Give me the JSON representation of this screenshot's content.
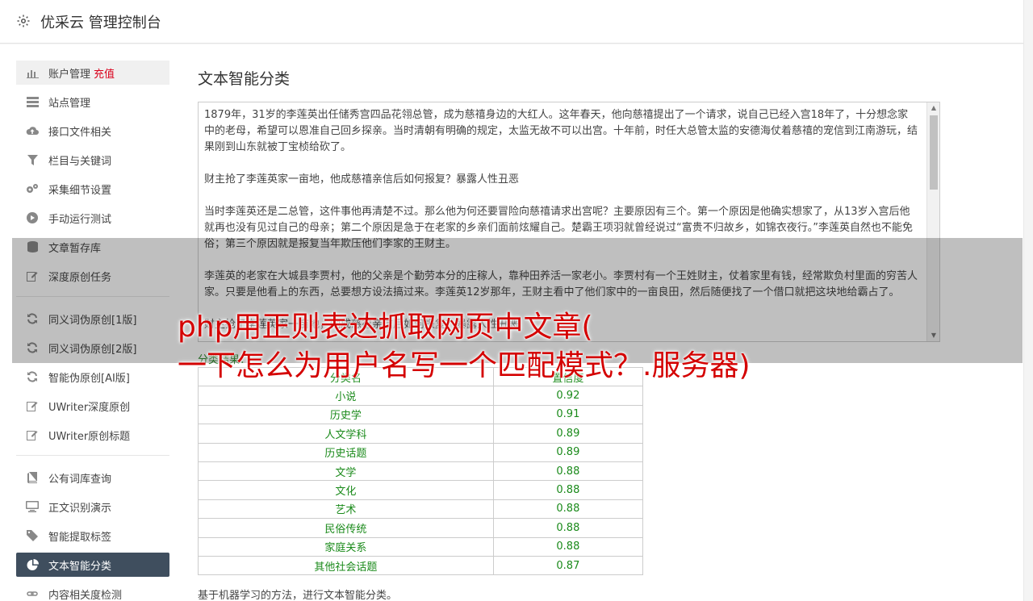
{
  "app": {
    "title": "优采云 管理控制台",
    "icon": "gear-icon"
  },
  "sidebar": {
    "groups": [
      [
        {
          "label": "账户管理",
          "extra": "充值",
          "icon": "bar-chart-icon"
        },
        {
          "label": "站点管理",
          "icon": "server-icon"
        },
        {
          "label": "接口文件相关",
          "icon": "cloud-upload-icon"
        },
        {
          "label": "栏目与关键词",
          "icon": "filter-icon"
        },
        {
          "label": "采集细节设置",
          "icon": "gears-icon"
        },
        {
          "label": "手动运行测试",
          "icon": "play-circle-icon"
        },
        {
          "label": "文章暂存库",
          "icon": "database-icon"
        },
        {
          "label": "深度原创任务",
          "icon": "edit-icon"
        }
      ],
      [
        {
          "label": "同义词伪原创[1版]",
          "icon": "refresh-icon"
        },
        {
          "label": "同义词伪原创[2版]",
          "icon": "refresh-icon"
        },
        {
          "label": "智能伪原创[AI版]",
          "icon": "refresh-icon"
        },
        {
          "label": "UWriter深度原创",
          "icon": "edit-icon"
        },
        {
          "label": "UWriter原创标题",
          "icon": "edit-icon"
        }
      ],
      [
        {
          "label": "公有词库查询",
          "icon": "book-icon"
        },
        {
          "label": "正文识别演示",
          "icon": "desktop-icon"
        },
        {
          "label": "智能提取标签",
          "icon": "tag-icon"
        },
        {
          "label": "文本智能分类",
          "icon": "pie-chart-icon",
          "active": true
        },
        {
          "label": "内容相关度检测",
          "icon": "link-icon"
        }
      ]
    ]
  },
  "main": {
    "title": "文本智能分类",
    "text": "1879年，31岁的李莲英出任储秀宫四品花翎总管，成为慈禧身边的大红人。这年春天，他向慈禧提出了一个请求，说自己已经入宫18年了，十分想念家中的老母，希望可以恩准自己回乡探亲。当时清朝有明确的规定，太监无故不可以出宫。十年前，时任大总管太监的安德海仗着慈禧的宠信到江南游玩，结果刚到山东就被丁宝桢给砍了。\n\n财主抢了李莲英家一亩地，他成慈禧亲信后如何报复？暴露人性丑恶\n\n当时李莲英还是二总管，这件事他再清楚不过。那么他为何还要冒险向慈禧请求出宫呢？主要原因有三个。第一个原因是他确实想家了，从13岁入宫后他就再也没有见过自己的母亲；第二个原因是急于在老家的乡亲们面前炫耀自己。楚霸王项羽就曾经说过“富贵不归故乡，如锦衣夜行。”李莲英自然也不能免俗；第三个原因就是报复当年欺压他们李家的王财主。\n\n李莲英的老家在大城县李贾村，他的父亲是个勤劳本分的庄稼人，靠种田养活一家老小。李贾村有一个王姓财主，仗着家里有钱，经常欺负村里面的穷苦人家。只要是他看上的东西，总要想方设法搞过来。李莲英12岁那年，王财主看中了他们家中的一亩良田，然后随便找了一个借口就把这块地给霸占了。\n\n财主抢了李莲英家一亩地，他成慈禧亲信后如何报复？暴露人性丑恶",
    "result_label": "分类结果：",
    "table": {
      "headers": [
        "分类名",
        "置信度"
      ],
      "rows": [
        [
          "小说",
          "0.92"
        ],
        [
          "历史学",
          "0.91"
        ],
        [
          "人文学科",
          "0.89"
        ],
        [
          "历史话题",
          "0.89"
        ],
        [
          "文学",
          "0.88"
        ],
        [
          "文化",
          "0.88"
        ],
        [
          "艺术",
          "0.88"
        ],
        [
          "民俗传统",
          "0.88"
        ],
        [
          "家庭关系",
          "0.88"
        ],
        [
          "其他社会话题",
          "0.87"
        ]
      ]
    },
    "description": "基于机器学习的方法，进行文本智能分类。"
  },
  "overlay": {
    "line1": "php用正则表达抓取网页中文章(",
    "line2": "一下怎么为用户名写一个匹配模式？.服务器)"
  }
}
